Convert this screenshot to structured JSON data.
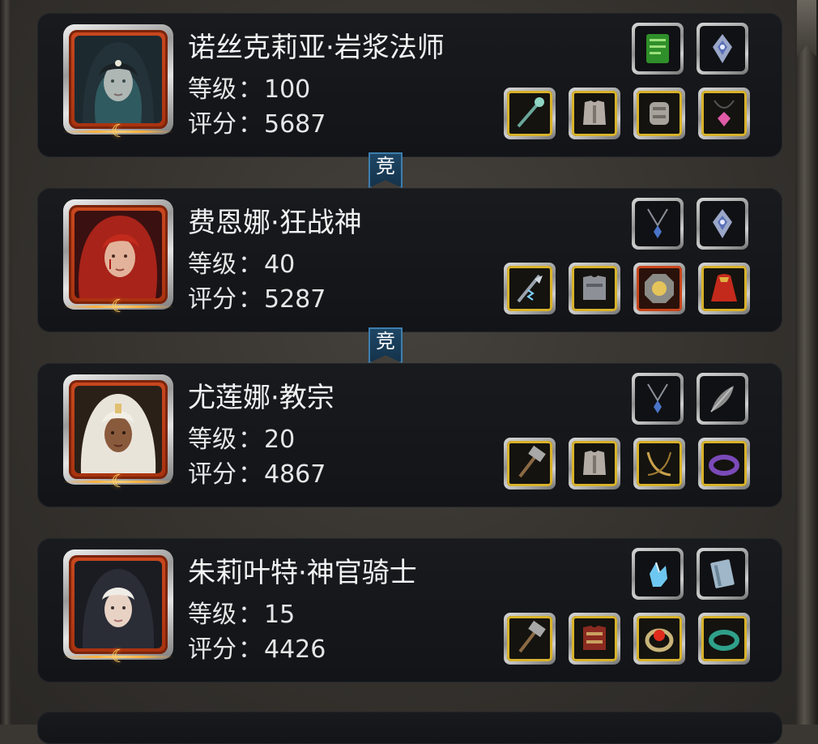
{
  "heroes": [
    {
      "name": "诺丝克莉亚·岩浆法师",
      "level_label": "等级",
      "level": "100",
      "score_label": "评分",
      "score": "5687",
      "top_slots": [
        "green-scroll-icon",
        "silver-amulet-icon"
      ],
      "bottom_slots": [
        "staff-icon",
        "chest-armor-icon",
        "bracer-icon",
        "pink-gem-necklace-icon"
      ]
    },
    {
      "name": "费恩娜·狂战神",
      "level_label": "等级",
      "level": "40",
      "score_label": "评分",
      "score": "5287",
      "top_slots": [
        "pendant-necklace-icon",
        "silver-amulet-icon"
      ],
      "bottom_slots": [
        "lightning-axe-icon",
        "plate-armor-icon",
        "octagon-shield-icon",
        "red-cloak-icon"
      ]
    },
    {
      "name": "尤莲娜·教宗",
      "level_label": "等级",
      "level": "20",
      "score_label": "评分",
      "score": "4867",
      "top_slots": [
        "pendant-necklace-icon",
        "feather-icon"
      ],
      "bottom_slots": [
        "hammer-icon",
        "chest-armor-icon",
        "gold-necklace-icon",
        "purple-bracelet-icon"
      ]
    },
    {
      "name": "朱莉叶特·神官骑士",
      "level_label": "等级",
      "level": "15",
      "score_label": "评分",
      "score": "4426",
      "top_slots": [
        "ice-crystal-icon",
        "blue-tome-icon"
      ],
      "bottom_slots": [
        "hammer-icon",
        "red-armor-icon",
        "red-gem-ring-icon",
        "jade-bracelet-icon"
      ]
    }
  ],
  "rank_tag_label": "竞",
  "colors": {
    "card_bg": "#15171b",
    "slot_gold": "#d8b22a",
    "slot_orange": "#c9461c",
    "rank_tag": "#1e4766"
  }
}
